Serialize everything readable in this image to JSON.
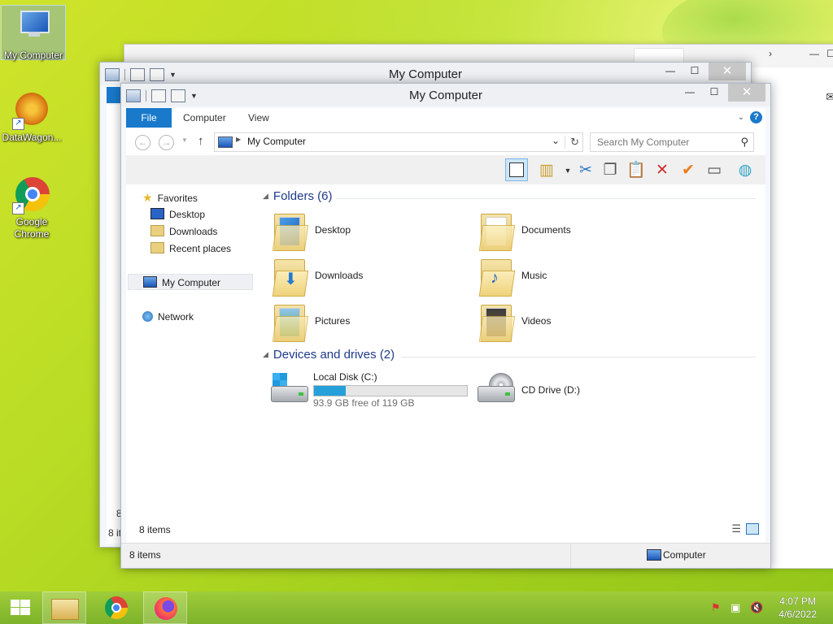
{
  "desktop": {
    "icons": [
      {
        "label": "My Computer",
        "icon": "computer-icon"
      },
      {
        "label": "DataWagon...",
        "icon": "datawagon-icon"
      },
      {
        "label": "Google Chrome",
        "icon": "chrome-icon"
      }
    ]
  },
  "back_window": {
    "title": "My Computer",
    "status_items": "8 it",
    "status_num": "8"
  },
  "explorer": {
    "title": "My Computer",
    "ribbon_tabs": [
      "File",
      "Computer",
      "View"
    ],
    "address": "My Computer",
    "search_placeholder": "Search My Computer",
    "toolbar_icons": [
      "preview-pane-icon",
      "properties-icon",
      "cut-icon",
      "copy-icon",
      "paste-icon",
      "delete-icon",
      "check-icon",
      "rename-icon",
      "globe-icon"
    ],
    "nav": {
      "favorites": "Favorites",
      "favorites_items": [
        "Desktop",
        "Downloads",
        "Recent places"
      ],
      "computer": "My Computer",
      "network": "Network"
    },
    "folders_header": "Folders (6)",
    "folders": [
      {
        "name": "Desktop",
        "icon": "desktop-folder-icon"
      },
      {
        "name": "Documents",
        "icon": "documents-folder-icon"
      },
      {
        "name": "Downloads",
        "icon": "downloads-folder-icon"
      },
      {
        "name": "Music",
        "icon": "music-folder-icon"
      },
      {
        "name": "Pictures",
        "icon": "pictures-folder-icon"
      },
      {
        "name": "Videos",
        "icon": "videos-folder-icon"
      }
    ],
    "drives_header": "Devices and drives (2)",
    "drives": [
      {
        "name": "Local Disk (C:)",
        "free": "93.9 GB free of 119 GB",
        "used_fraction": 0.21
      },
      {
        "name": "CD Drive (D:)"
      }
    ],
    "status_inner": "8 items",
    "status_items": "8 items",
    "status_location": "Computer"
  },
  "taskbar": {
    "time": "4:07 PM",
    "date": "4/6/2022",
    "accent": "#1979ca"
  }
}
